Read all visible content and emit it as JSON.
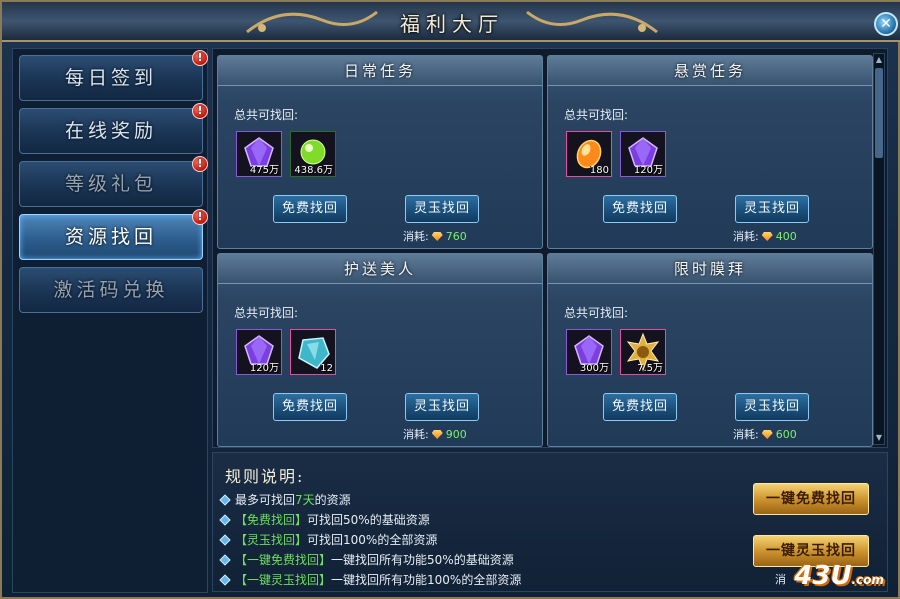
{
  "window": {
    "title": "福利大厅",
    "close_icon": "close-icon"
  },
  "nav": {
    "items": [
      {
        "label": "每日签到",
        "alert": "!"
      },
      {
        "label": "在线奖励",
        "alert": "!"
      },
      {
        "label": "等级礼包",
        "alert": "!"
      },
      {
        "label": "资源找回",
        "alert": "!",
        "active": true
      },
      {
        "label": "激活码兑换"
      }
    ]
  },
  "common": {
    "total_label": "总共可找回:",
    "free_btn": "免费找回",
    "jade_btn": "灵玉找回",
    "cost_label": "消耗:"
  },
  "cards": [
    {
      "title": "日常任务",
      "items": [
        {
          "icon": "purple-diamond-icon",
          "qty": "475万"
        },
        {
          "icon": "green-orb-icon",
          "qty": "438.6万"
        }
      ],
      "cost": "760"
    },
    {
      "title": "悬赏任务",
      "items": [
        {
          "icon": "fire-orb-icon",
          "qty": "180"
        },
        {
          "icon": "purple-diamond-icon",
          "qty": "120万"
        }
      ],
      "cost": "400"
    },
    {
      "title": "护送美人",
      "items": [
        {
          "icon": "purple-diamond-icon",
          "qty": "120万"
        },
        {
          "icon": "cyan-crystal-icon",
          "qty": "12"
        }
      ],
      "cost": "900"
    },
    {
      "title": "限时膜拜",
      "items": [
        {
          "icon": "purple-diamond-icon",
          "qty": "300万"
        },
        {
          "icon": "gold-medal-icon",
          "qty": "7.5万"
        }
      ],
      "cost": "600"
    }
  ],
  "rules": {
    "title": "规则说明:",
    "lines": [
      {
        "pre": "最多可找回",
        "hl": "7天",
        "post": "的资源"
      },
      {
        "pre": "",
        "hl": "【免费找回】",
        "post": "可找回50%的基础资源"
      },
      {
        "pre": "",
        "hl": "【灵玉找回】",
        "post": "可找回100%的全部资源"
      },
      {
        "pre": "",
        "hl": "【一键免费找回】",
        "post": "一键找回所有功能50%的基础资源"
      },
      {
        "pre": "",
        "hl": "【一键灵玉找回】",
        "post": "一键找回所有功能100%的全部资源"
      }
    ],
    "btn_free_all": "一键免费找回",
    "btn_jade_all": "一键灵玉找回",
    "cost_peek": "消"
  },
  "watermark": {
    "brand": "43U",
    "domain": ".com"
  },
  "colors": {
    "highlight": "#6ee05a",
    "cost_value": "#7ff06a",
    "gold_button": "#c98f2b"
  }
}
